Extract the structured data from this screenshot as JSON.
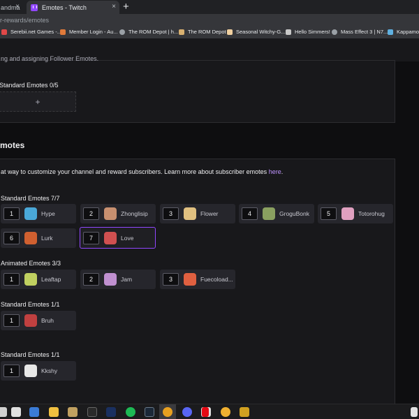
{
  "browser": {
    "tab_partial": "andma",
    "tab_active": "Emotes - Twitch",
    "new_tab": "+",
    "close_glyph": "×",
    "url": "r-rewards/emotes",
    "bookmarks": [
      {
        "label": "Serebii.net Games -...",
        "color": "#e04848"
      },
      {
        "label": "Member Login - Au...",
        "color": "#e07a3a"
      },
      {
        "label": "The ROM Depot | h...",
        "color": "#9aa0a6"
      },
      {
        "label": "The ROM Depot",
        "color": "#d8b070"
      },
      {
        "label": "Seasonal Witchy-G...",
        "color": "#f0d0a0"
      },
      {
        "label": "Hello Simmers!",
        "color": "#c8c8c8"
      },
      {
        "label": "Mass Effect 3 | N7...",
        "color": "#9aa0a6"
      },
      {
        "label": "Kappamon",
        "color": "#5fb0e0"
      }
    ]
  },
  "top_section": {
    "partial_text": "ng and assigning Follower Emotes.",
    "follower_title": "Standard Emotes 0/5",
    "add_glyph": "+"
  },
  "sub_section": {
    "heading": "motes",
    "description": "at way to customize your channel and reward subscribers. Learn more about subscriber emotes ",
    "link": "here",
    "after_link": ".",
    "groups": [
      {
        "title": "Standard Emotes 7/7",
        "emotes": [
          {
            "num": "1",
            "name": "Hype",
            "color": "#4aa8d8"
          },
          {
            "num": "2",
            "name": "Zhonglisip",
            "color": "#c89070"
          },
          {
            "num": "3",
            "name": "Flower",
            "color": "#e0c080"
          },
          {
            "num": "4",
            "name": "GroguBonk",
            "color": "#8aa060"
          },
          {
            "num": "5",
            "name": "Totorohug",
            "color": "#e0a0c0"
          },
          {
            "num": "6",
            "name": "Lurk",
            "color": "#d06030"
          },
          {
            "num": "7",
            "name": "Love",
            "color": "#d05050"
          }
        ]
      },
      {
        "title": "Animated Emotes 3/3",
        "emotes": [
          {
            "num": "1",
            "name": "Leaftap",
            "color": "#c0d060"
          },
          {
            "num": "2",
            "name": "Jam",
            "color": "#c090d0"
          },
          {
            "num": "3",
            "name": "Fuecoload...",
            "color": "#e06040"
          }
        ]
      },
      {
        "title": "Standard Emotes 1/1",
        "emotes": [
          {
            "num": "1",
            "name": "Bruh",
            "color": "#c04040"
          }
        ]
      },
      {
        "title": "Standard Emotes 1/1",
        "emotes": [
          {
            "num": "1",
            "name": "Kkshy",
            "color": "#e8e8e8"
          }
        ]
      }
    ]
  },
  "taskbar": {
    "icons": [
      {
        "name": "keyboard-icon",
        "color": "#d0d0d0"
      },
      {
        "name": "store-icon",
        "color": "#3a7bd5"
      },
      {
        "name": "file-explorer-icon",
        "color": "#f0c040"
      },
      {
        "name": "game-icon",
        "color": "#c0a060"
      },
      {
        "name": "epic-games-icon",
        "color": "#2a2a2a"
      },
      {
        "name": "disney-icon",
        "color": "#1a3060"
      },
      {
        "name": "spotify-icon",
        "color": "#1db954"
      },
      {
        "name": "steam-icon",
        "color": "#1b2838"
      },
      {
        "name": "chrome-icon",
        "color": "#e8a020"
      },
      {
        "name": "discord-icon",
        "color": "#5865f2"
      },
      {
        "name": "app-icon",
        "color": "#e0e0e0"
      },
      {
        "name": "netflix-icon",
        "color": "#e50914"
      },
      {
        "name": "overwolf-icon",
        "color": "#f0b030"
      },
      {
        "name": "blitz-icon",
        "color": "#d0a020"
      }
    ]
  },
  "colors": {
    "accent": "#9147ff",
    "link": "#bf94ff",
    "background": "#0e0e10",
    "card": "#18181b"
  }
}
